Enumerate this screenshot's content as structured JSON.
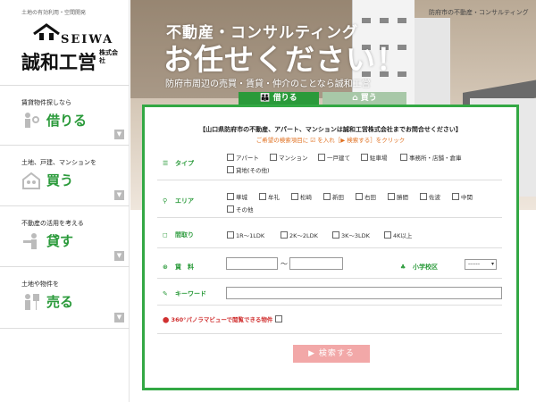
{
  "sidebar": {
    "tagline": "土地の有効利用・空間開発",
    "logo": {
      "en": "SEIWA",
      "jp": "誠和工営",
      "kaisha": "株式会社"
    },
    "items": [
      {
        "sub": "賃貸物件探しなら",
        "main": "借りる",
        "icon": "person-key-icon"
      },
      {
        "sub": "土地、戸建、マンションを",
        "main": "買う",
        "icon": "family-icon"
      },
      {
        "sub": "不動産の活用を考える",
        "main": "貸す",
        "icon": "person-lend-icon"
      },
      {
        "sub": "土地や物件を",
        "main": "売る",
        "icon": "person-sign-icon"
      }
    ],
    "arrow": "▼"
  },
  "hero": {
    "note": "防府市の不動産・コンサルティング",
    "title1": "不動産・コンサルティング",
    "title2": "お任せください！",
    "subtitle": "防府市周辺の売買・賃貸・仲介のことなら誠和工営"
  },
  "tabs": [
    {
      "label": "借りる",
      "icon": "people-icon",
      "active": true
    },
    {
      "label": "買う",
      "icon": "house-icon",
      "active": false
    }
  ],
  "form": {
    "intro": "【山口県防府市の不動産、アパート、マンションは誠和工営株式会社までお問合せください】",
    "hint": "ご希望の検索項目に ☑ を入れ［▶ 検索する］をクリック",
    "type": {
      "label": "タイプ",
      "options": [
        "アパート",
        "マンション",
        "一戸建て",
        "駐車場",
        "事務所・店舗・倉庫",
        "貸地(その他)"
      ]
    },
    "area": {
      "label": "エリア",
      "options": [
        "華城",
        "牟礼",
        "松崎",
        "新田",
        "右田",
        "勝間",
        "佐波",
        "中関",
        "その他"
      ]
    },
    "layout": {
      "label": "間取り",
      "options": [
        "1R〜1LDK",
        "2K〜2LDK",
        "3K〜3LDK",
        "4K以上"
      ]
    },
    "rent": {
      "label": "賃　料",
      "separator": "〜"
    },
    "school": {
      "label": "小学校区",
      "selected": "------"
    },
    "keyword": {
      "label": "キーワード",
      "value": ""
    },
    "panorama": {
      "label": "360°パノラマビューで閲覧できる物件"
    },
    "submit": "▶ 検索する"
  },
  "colors": {
    "accent": "#2a9a3a",
    "border": "#33a844",
    "hint": "#e07020",
    "submit": "#f2a8a8"
  }
}
